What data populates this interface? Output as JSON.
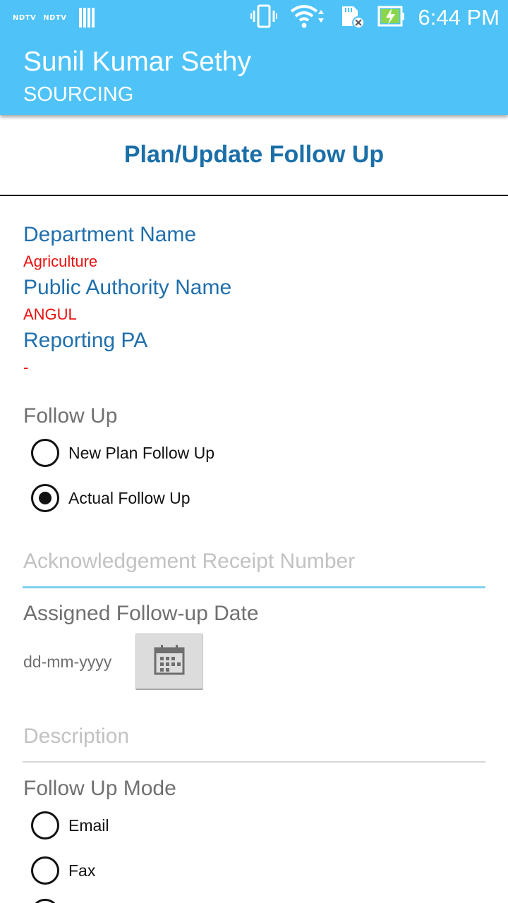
{
  "status_bar": {
    "notification_1": "NDTV",
    "notification_2": "NDTV",
    "time": "6:44 PM",
    "icons": [
      "vibrate-icon",
      "wifi-icon",
      "sd-card-icon",
      "battery-charging-icon"
    ]
  },
  "app_bar": {
    "title": "Sunil Kumar Sethy",
    "subtitle": "SOURCING",
    "color": "#4fc3f7"
  },
  "page": {
    "heading": "Plan/Update Follow Up",
    "heading_color": "#1a6fa8"
  },
  "details": {
    "department_label": "Department Name",
    "department_value": "Agriculture",
    "authority_label": "Public Authority Name",
    "authority_value": "ANGUL",
    "reporting_label": "Reporting PA",
    "reporting_value": "-",
    "label_color": "#1f6fad",
    "value_color": "#e8110e"
  },
  "follow_up": {
    "label": "Follow Up",
    "options": [
      {
        "label": "New Plan Follow Up",
        "checked": false
      },
      {
        "label": "Actual Follow Up",
        "checked": true
      }
    ]
  },
  "ack_receipt": {
    "placeholder": "Acknowledgement Receipt Number",
    "focused": true,
    "accent": "#7fd0ef"
  },
  "assigned_date": {
    "label": "Assigned Follow-up Date",
    "value": "dd-mm-yyyy",
    "button_icon": "calendar-icon"
  },
  "description": {
    "placeholder": "Description"
  },
  "follow_up_mode": {
    "label": "Follow Up Mode",
    "options": [
      {
        "label": "Email",
        "checked": false
      },
      {
        "label": "Fax",
        "checked": false
      }
    ]
  }
}
